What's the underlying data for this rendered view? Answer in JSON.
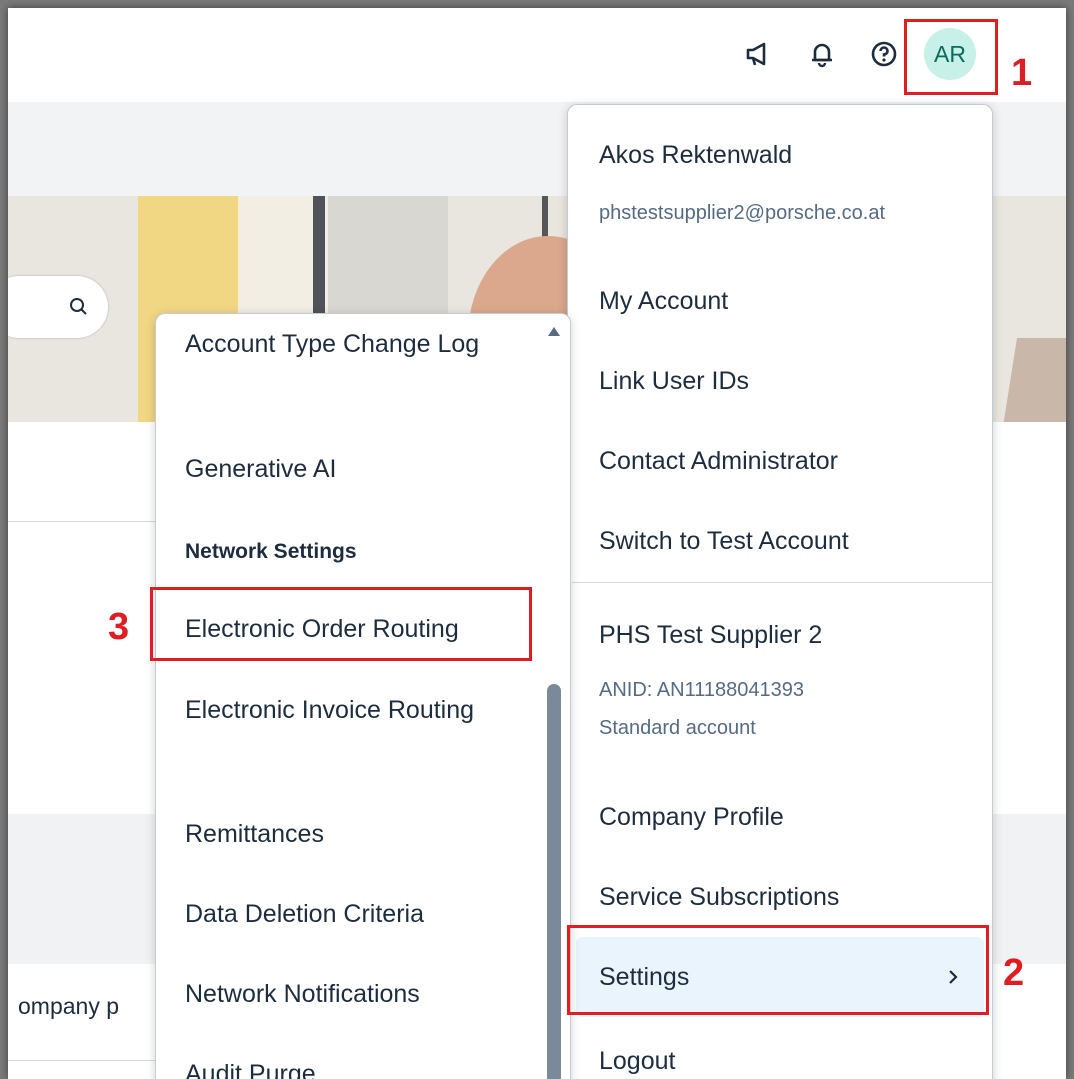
{
  "shellbar": {
    "icons": [
      "megaphone-icon",
      "bell-icon",
      "help-icon"
    ],
    "avatar_initials": "AR",
    "avatar_color": "#c7f0e8"
  },
  "background": {
    "company_text": "ompany p"
  },
  "user_menu": {
    "user_name": "Akos Rektenwald",
    "user_email": "phstestsupplier2@porsche.co.at",
    "items_account": [
      "My Account",
      "Link User IDs",
      "Contact Administrator",
      "Switch to Test Account"
    ],
    "company_name": "PHS Test Supplier 2",
    "anid": "ANID: AN11188041393",
    "account_type": "Standard account",
    "company_profile": "Company Profile",
    "service_subscriptions": "Service Subscriptions",
    "settings": "Settings",
    "logout": "Logout"
  },
  "settings_submenu": {
    "items_top": [
      "Account Type Change Log",
      "Generative AI"
    ],
    "heading": "Network Settings",
    "items_network": [
      "Electronic Order Routing",
      "Electronic Invoice Routing",
      "Remittances",
      "Data Deletion Criteria",
      "Network Notifications",
      "Audit Purge"
    ]
  },
  "annotations": {
    "step1": "1",
    "step2": "2",
    "step3": "3",
    "color": "#e11d24"
  }
}
